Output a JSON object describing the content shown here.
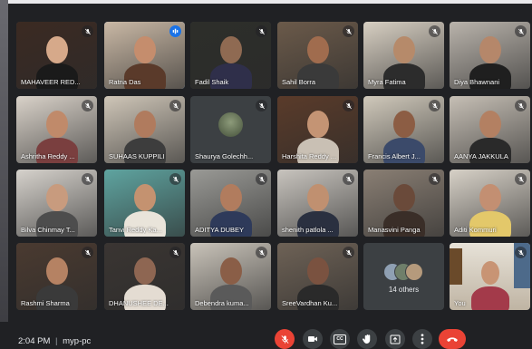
{
  "meeting": {
    "time": "2:04 PM",
    "separator": "|",
    "code": "myp-pc"
  },
  "participants": [
    {
      "name": "MAHAVEER RED...",
      "muted": true
    },
    {
      "name": "Ratna Das",
      "muted": false,
      "speaking": true
    },
    {
      "name": "Fadil Shaik",
      "muted": true
    },
    {
      "name": "Sahil Borra",
      "muted": true
    },
    {
      "name": "Myra Fatima",
      "muted": true
    },
    {
      "name": "Diya Bhawnani",
      "muted": true
    },
    {
      "name": "Ashritha Reddy ...",
      "muted": true
    },
    {
      "name": "SUHAAS KUPPILI",
      "muted": true
    },
    {
      "name": "Shaurya Golechh...",
      "muted": true,
      "avatar": true
    },
    {
      "name": "Harshita Reddy ...",
      "muted": true
    },
    {
      "name": "Francis Albert J...",
      "muted": true
    },
    {
      "name": "AANYA JAKKULA",
      "muted": true
    },
    {
      "name": "Bilva Chinmay T...",
      "muted": true
    },
    {
      "name": "Tanvi Reddy Ka...",
      "muted": true
    },
    {
      "name": "ADITYA DUBEY",
      "muted": true
    },
    {
      "name": "shenith patlola ...",
      "muted": true
    },
    {
      "name": "Manasvini Panga",
      "muted": true
    },
    {
      "name": "Aditi Kommuri",
      "muted": true
    },
    {
      "name": "Rashmi Sharma",
      "muted": true
    },
    {
      "name": "DHANUSHEE DE...",
      "muted": true
    },
    {
      "name": "Debendra kuma...",
      "muted": true
    },
    {
      "name": "SreeVardhan Ku...",
      "muted": true
    }
  ],
  "others": {
    "label": "14 others"
  },
  "self": {
    "label": "You",
    "muted": true
  },
  "controls": {
    "mic": "mic-off-icon",
    "camera": "camera-icon",
    "captions": "captions-icon",
    "captions_text": "CC",
    "raise_hand": "hand-icon",
    "present": "present-icon",
    "more": "more-vert-icon",
    "hangup": "phone-hangup-icon"
  },
  "colors": {
    "background": "#202124",
    "tile": "#3c4043",
    "speaking_border": "#8ab4f8",
    "active_mic": "#1a73e8",
    "danger": "#ea4335"
  }
}
